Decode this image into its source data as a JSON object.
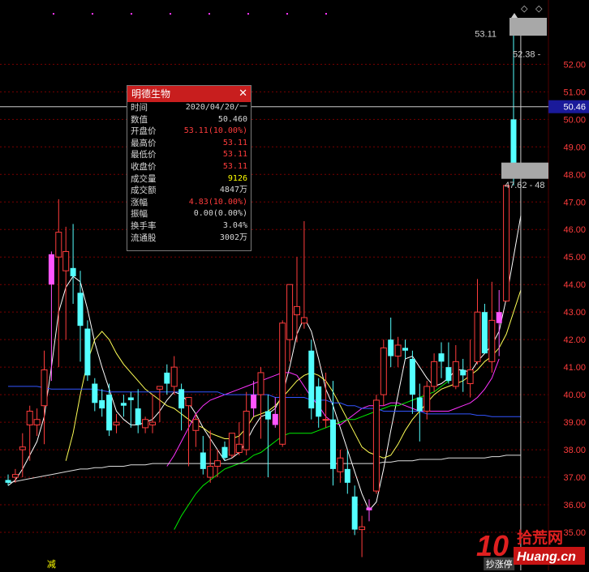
{
  "chart_data": {
    "type": "candlestick",
    "y_ticks": [
      "52.00",
      "51.00",
      "50.00",
      "49.00",
      "48.00",
      "47.00",
      "46.00",
      "45.00",
      "44.00",
      "43.00",
      "42.00",
      "41.00",
      "40.00",
      "39.00",
      "38.00",
      "37.00",
      "36.00",
      "35.00"
    ],
    "ylim": [
      34.0,
      53.6
    ],
    "candles": [
      {
        "o": 36.9,
        "h": 37.1,
        "l": 36.7,
        "c": 36.8
      },
      {
        "o": 37.0,
        "h": 37.3,
        "l": 36.8,
        "c": 37.1
      },
      {
        "o": 38.0,
        "h": 38.6,
        "l": 37.0,
        "c": 38.1
      },
      {
        "o": 38.9,
        "h": 39.6,
        "l": 37.6,
        "c": 39.4
      },
      {
        "o": 38.9,
        "h": 39.5,
        "l": 38.5,
        "c": 39.1
      },
      {
        "o": 39.6,
        "h": 41.6,
        "l": 38.2,
        "c": 40.9
      },
      {
        "o": 44.0,
        "h": 45.2,
        "l": 40.5,
        "c": 45.1
      },
      {
        "o": 45.0,
        "h": 47.1,
        "l": 41.0,
        "c": 45.9
      },
      {
        "o": 44.5,
        "h": 46.1,
        "l": 42.0,
        "c": 45.2
      },
      {
        "o": 44.6,
        "h": 46.2,
        "l": 43.3,
        "c": 44.3
      },
      {
        "o": 43.7,
        "h": 44.5,
        "l": 41.2,
        "c": 42.5
      },
      {
        "o": 42.4,
        "h": 42.7,
        "l": 40.5,
        "c": 40.7
      },
      {
        "o": 40.4,
        "h": 40.6,
        "l": 39.4,
        "c": 39.7
      },
      {
        "o": 39.8,
        "h": 40.2,
        "l": 39.2,
        "c": 39.5
      },
      {
        "o": 40.0,
        "h": 40.4,
        "l": 38.5,
        "c": 38.7
      },
      {
        "o": 38.9,
        "h": 39.3,
        "l": 38.6,
        "c": 39.0
      },
      {
        "o": 39.7,
        "h": 40.0,
        "l": 39.2,
        "c": 39.6
      },
      {
        "o": 39.9,
        "h": 40.1,
        "l": 38.8,
        "c": 39.8
      },
      {
        "o": 39.5,
        "h": 40.2,
        "l": 38.6,
        "c": 38.9
      },
      {
        "o": 38.8,
        "h": 39.2,
        "l": 38.6,
        "c": 39.1
      },
      {
        "o": 38.9,
        "h": 40.0,
        "l": 38.6,
        "c": 39.0
      },
      {
        "o": 40.2,
        "h": 40.3,
        "l": 39.0,
        "c": 40.3
      },
      {
        "o": 40.8,
        "h": 41.1,
        "l": 40.0,
        "c": 40.4
      },
      {
        "o": 40.3,
        "h": 41.4,
        "l": 40.0,
        "c": 41.0
      },
      {
        "o": 40.2,
        "h": 40.4,
        "l": 38.7,
        "c": 39.5
      },
      {
        "o": 39.6,
        "h": 39.8,
        "l": 37.4,
        "c": 39.9
      },
      {
        "o": 38.7,
        "h": 39.3,
        "l": 38.1,
        "c": 39.1
      },
      {
        "o": 37.9,
        "h": 38.5,
        "l": 37.1,
        "c": 37.3
      },
      {
        "o": 37.0,
        "h": 38.7,
        "l": 36.8,
        "c": 37.4
      },
      {
        "o": 37.4,
        "h": 38.0,
        "l": 37.0,
        "c": 37.6
      },
      {
        "o": 38.1,
        "h": 38.3,
        "l": 37.6,
        "c": 37.7
      },
      {
        "o": 37.8,
        "h": 38.6,
        "l": 37.7,
        "c": 38.6
      },
      {
        "o": 37.9,
        "h": 39.0,
        "l": 37.8,
        "c": 38.2
      },
      {
        "o": 38.0,
        "h": 40.1,
        "l": 37.8,
        "c": 39.4
      },
      {
        "o": 39.5,
        "h": 40.5,
        "l": 39.2,
        "c": 40.0
      },
      {
        "o": 40.0,
        "h": 41.0,
        "l": 38.4,
        "c": 40.8
      },
      {
        "o": 39.4,
        "h": 40.0,
        "l": 37.0,
        "c": 39.1
      },
      {
        "o": 39.3,
        "h": 39.9,
        "l": 38.8,
        "c": 38.9
      },
      {
        "o": 38.2,
        "h": 42.7,
        "l": 38.1,
        "c": 42.6
      },
      {
        "o": 42.0,
        "h": 44.0,
        "l": 41.2,
        "c": 44.0
      },
      {
        "o": 42.9,
        "h": 45.0,
        "l": 41.9,
        "c": 43.2
      },
      {
        "o": 42.6,
        "h": 46.3,
        "l": 42.4,
        "c": 42.8
      },
      {
        "o": 41.6,
        "h": 42.0,
        "l": 39.1,
        "c": 39.5
      },
      {
        "o": 40.3,
        "h": 40.6,
        "l": 38.8,
        "c": 39.2
      },
      {
        "o": 39.1,
        "h": 40.8,
        "l": 38.8,
        "c": 39.1
      },
      {
        "o": 39.1,
        "h": 40.5,
        "l": 36.7,
        "c": 37.3
      },
      {
        "o": 37.2,
        "h": 38.0,
        "l": 36.8,
        "c": 37.7
      },
      {
        "o": 37.3,
        "h": 38.0,
        "l": 36.4,
        "c": 36.8
      },
      {
        "o": 36.3,
        "h": 36.7,
        "l": 34.9,
        "c": 35.1
      },
      {
        "o": 35.1,
        "h": 35.6,
        "l": 34.1,
        "c": 35.2
      },
      {
        "o": 35.8,
        "h": 36.2,
        "l": 35.4,
        "c": 35.9
      },
      {
        "o": 36.5,
        "h": 40.0,
        "l": 36.4,
        "c": 39.8
      },
      {
        "o": 40.0,
        "h": 42.0,
        "l": 39.6,
        "c": 41.7
      },
      {
        "o": 42.0,
        "h": 42.8,
        "l": 41.0,
        "c": 41.4
      },
      {
        "o": 41.4,
        "h": 42.1,
        "l": 41.0,
        "c": 41.8
      },
      {
        "o": 41.7,
        "h": 42.0,
        "l": 41.3,
        "c": 41.6
      },
      {
        "o": 41.3,
        "h": 41.6,
        "l": 39.3,
        "c": 40.0
      },
      {
        "o": 39.9,
        "h": 40.4,
        "l": 38.3,
        "c": 39.4
      },
      {
        "o": 39.4,
        "h": 40.5,
        "l": 39.1,
        "c": 40.3
      },
      {
        "o": 40.3,
        "h": 41.5,
        "l": 40.1,
        "c": 41.2
      },
      {
        "o": 41.5,
        "h": 41.9,
        "l": 40.6,
        "c": 41.2
      },
      {
        "o": 41.0,
        "h": 41.9,
        "l": 40.4,
        "c": 40.5
      },
      {
        "o": 40.3,
        "h": 41.8,
        "l": 40.2,
        "c": 41.2
      },
      {
        "o": 40.9,
        "h": 41.3,
        "l": 40.1,
        "c": 40.7
      },
      {
        "o": 40.4,
        "h": 42.0,
        "l": 39.9,
        "c": 40.9
      },
      {
        "o": 41.2,
        "h": 44.2,
        "l": 41.1,
        "c": 43.0
      },
      {
        "o": 43.0,
        "h": 43.3,
        "l": 41.5,
        "c": 41.5
      },
      {
        "o": 41.2,
        "h": 44.1,
        "l": 40.8,
        "c": 42.7
      },
      {
        "o": 42.6,
        "h": 43.8,
        "l": 41.4,
        "c": 43.0
      },
      {
        "o": 43.4,
        "h": 47.6,
        "l": 43.4,
        "c": 47.6
      },
      {
        "o": 50.0,
        "h": 53.1,
        "l": 47.6,
        "c": 48.2
      },
      {
        "o": 53.11,
        "h": 53.11,
        "l": 53.11,
        "c": 53.11
      }
    ],
    "marked": [
      6,
      34,
      37,
      50,
      68
    ],
    "ma_lines": [
      {
        "color": "#ffffff",
        "values": [
          36.7,
          36.9,
          37.3,
          37.8,
          38.3,
          39.2,
          41.0,
          43.0,
          43.9,
          44.3,
          44.1,
          43.1,
          41.9,
          41.0,
          40.2,
          39.4,
          39.1,
          38.9,
          38.9,
          39.0,
          39.1,
          39.4,
          39.8,
          40.1,
          40.0,
          39.7,
          39.3,
          38.8,
          38.4,
          38.0,
          37.6,
          37.7,
          37.9,
          38.3,
          38.8,
          39.2,
          39.3,
          39.5,
          40.0,
          41.0,
          42.2,
          42.8,
          42.3,
          41.3,
          40.2,
          39.6,
          38.8,
          38.0,
          37.2,
          36.4,
          35.8,
          36.1,
          37.3,
          38.7,
          40.0,
          41.3,
          41.4,
          41.0,
          40.6,
          40.3,
          40.4,
          40.6,
          40.9,
          40.9,
          40.8,
          41.2,
          41.5,
          41.8,
          42.3,
          43.5,
          45.0,
          46.5
        ]
      },
      {
        "color": "#ffff55",
        "values": [
          null,
          null,
          null,
          null,
          null,
          null,
          null,
          null,
          37.6,
          38.6,
          40.0,
          41.2,
          42.0,
          42.3,
          42.0,
          41.5,
          41.1,
          40.8,
          40.5,
          40.2,
          40.0,
          39.8,
          39.6,
          39.5,
          39.3,
          39.1,
          38.9,
          38.8,
          38.6,
          38.5,
          38.4,
          38.4,
          38.5,
          38.8,
          39.2,
          39.3,
          39.4,
          39.6,
          39.9,
          40.2,
          40.5,
          40.7,
          40.8,
          40.7,
          40.5,
          40.1,
          39.6,
          39.1,
          38.6,
          38.1,
          37.9,
          37.8,
          37.7,
          37.8,
          38.2,
          38.7,
          39.1,
          39.4,
          39.7,
          40.0,
          40.2,
          40.3,
          40.4,
          40.5,
          40.7,
          40.9,
          41.2,
          41.4,
          41.7,
          42.2,
          43.0,
          43.8
        ]
      },
      {
        "color": "#ff33ff",
        "values": [
          null,
          null,
          null,
          null,
          null,
          null,
          null,
          null,
          null,
          null,
          null,
          null,
          null,
          null,
          null,
          null,
          null,
          null,
          null,
          null,
          null,
          null,
          37.4,
          37.8,
          38.3,
          38.8,
          39.3,
          39.6,
          39.8,
          39.9,
          40.0,
          40.1,
          40.2,
          40.3,
          40.4,
          40.5,
          40.6,
          40.7,
          40.8,
          40.8,
          40.7,
          40.3,
          39.9,
          39.6,
          39.2,
          39.0,
          38.9,
          39.1,
          39.3,
          39.5,
          39.6,
          39.6,
          39.6,
          39.7,
          39.7,
          39.6,
          39.5,
          39.4,
          39.4,
          39.4,
          39.4,
          39.4,
          39.5,
          39.6,
          39.7,
          39.9,
          40.2,
          40.6,
          41.3
        ]
      },
      {
        "color": "#00ee00",
        "values": [
          null,
          null,
          null,
          null,
          null,
          null,
          null,
          null,
          null,
          null,
          null,
          null,
          null,
          null,
          null,
          null,
          null,
          null,
          null,
          null,
          null,
          null,
          null,
          35.1,
          35.6,
          36.0,
          36.4,
          36.7,
          36.9,
          37.1,
          37.3,
          37.4,
          37.5,
          37.6,
          37.8,
          37.9,
          38.1,
          38.3,
          38.5,
          38.6,
          38.6,
          38.6,
          38.6,
          38.7,
          38.8,
          38.9,
          39.0,
          39.1,
          39.1,
          39.2,
          39.3,
          39.4,
          39.5,
          39.6,
          39.6,
          39.7,
          39.8,
          39.9,
          40.0,
          40.1,
          40.3,
          40.5
        ]
      },
      {
        "color": "#3355ff",
        "values": [
          40.3,
          40.3,
          40.3,
          40.3,
          40.3,
          40.25,
          40.2,
          40.2,
          40.2,
          40.2,
          40.2,
          40.2,
          40.2,
          40.15,
          40.1,
          40.1,
          40.1,
          40.1,
          40.1,
          40.1,
          40.1,
          40.1,
          40.1,
          40.1,
          40.1,
          40.1,
          40.1,
          40.1,
          40.1,
          40.1,
          40.0,
          40.0,
          40.0,
          40.0,
          40.0,
          40.0,
          40.0,
          39.9,
          39.9,
          39.9,
          39.9,
          39.9,
          39.8,
          39.8,
          39.8,
          39.7,
          39.7,
          39.6,
          39.6,
          39.5,
          39.5,
          39.5,
          39.4,
          39.4,
          39.4,
          39.4,
          39.4,
          39.4,
          39.3,
          39.3,
          39.3,
          39.3,
          39.3,
          39.3,
          39.3,
          39.25,
          39.25,
          39.2,
          39.2,
          39.2,
          39.2,
          39.2
        ]
      },
      {
        "color": "#dddddd",
        "values": [
          36.8,
          36.85,
          36.9,
          36.95,
          37.0,
          37.05,
          37.1,
          37.15,
          37.2,
          37.25,
          37.3,
          37.3,
          37.35,
          37.35,
          37.4,
          37.4,
          37.4,
          37.45,
          37.45,
          37.45,
          37.5,
          37.5,
          37.5,
          37.5,
          37.5,
          37.5,
          37.5,
          37.5,
          37.5,
          37.5,
          37.5,
          37.5,
          37.5,
          37.5,
          37.5,
          37.5,
          37.5,
          37.5,
          37.5,
          37.5,
          37.5,
          37.5,
          37.5,
          37.5,
          37.5,
          37.5,
          37.5,
          37.5,
          37.5,
          37.5,
          37.5,
          37.5,
          37.55,
          37.55,
          37.6,
          37.6,
          37.6,
          37.65,
          37.65,
          37.65,
          37.65,
          37.7,
          37.7,
          37.7,
          37.7,
          37.7,
          37.7,
          37.75,
          37.75,
          37.8,
          37.8,
          37.8
        ]
      }
    ],
    "crosshair": {
      "price": "50.46"
    },
    "price_markers": [
      {
        "label": "53.11",
        "price": 53.11
      },
      {
        "label": "52.38 -",
        "price": 52.38
      },
      {
        "label": "47.62 - 48",
        "price": 47.62
      }
    ],
    "bottom_labels": [
      {
        "text": "减",
        "index": 6
      },
      {
        "text": "抄涨停",
        "index": 68
      }
    ]
  },
  "info_panel": {
    "title": "明德生物",
    "rows": [
      {
        "label": "时间",
        "value": "2020/04/20/一",
        "color": "#d8d8d8"
      },
      {
        "label": "数值",
        "value": "50.460",
        "color": "#d8d8d8"
      },
      {
        "label": "开盘价",
        "value": "53.11(10.00%)",
        "color": "#ff3c3c"
      },
      {
        "label": "最高价",
        "value": "53.11",
        "color": "#ff3c3c"
      },
      {
        "label": "最低价",
        "value": "53.11",
        "color": "#ff3c3c"
      },
      {
        "label": "收盘价",
        "value": "53.11",
        "color": "#ff3c3c"
      },
      {
        "label": "成交量",
        "value": "9126",
        "color": "#ffff00"
      },
      {
        "label": "成交额",
        "value": "4847万",
        "color": "#d8d8d8"
      },
      {
        "label": "涨幅",
        "value": "4.83(10.00%)",
        "color": "#ff3c3c"
      },
      {
        "label": "振幅",
        "value": "0.00(0.00%)",
        "color": "#d8d8d8"
      },
      {
        "label": "换手率",
        "value": "3.04%",
        "color": "#d8d8d8"
      },
      {
        "label": "流通股",
        "value": "3002万",
        "color": "#d8d8d8"
      }
    ]
  },
  "watermark": {
    "digits": "10",
    "cn": "拾荒网",
    "domain": "Huang.cn"
  },
  "colors": {
    "up": "#ff3c3c",
    "down": "#54ffff",
    "marked": "#ff55ff",
    "grid": "#7a0000",
    "crosshair": "#cccccc"
  }
}
